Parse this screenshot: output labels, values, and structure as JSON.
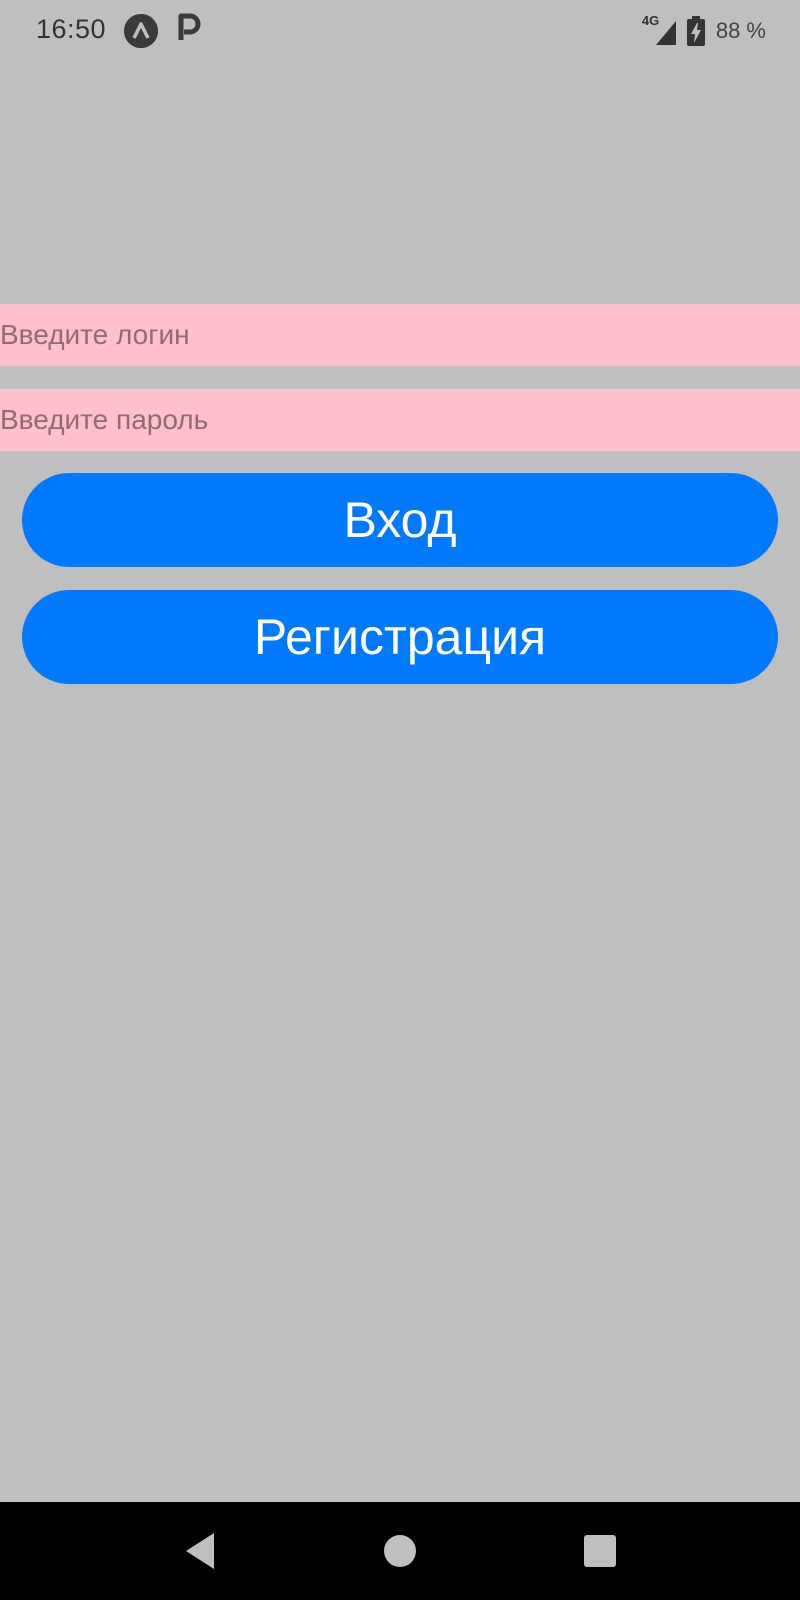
{
  "status_bar": {
    "time": "16:50",
    "notification_icons": [
      "arc-a-icon",
      "p-icon"
    ],
    "network_label": "4G",
    "battery_text": "88 %"
  },
  "login_form": {
    "login_placeholder": "Введите логин",
    "login_value": "",
    "password_placeholder": "Введите пароль",
    "password_value": "",
    "login_button_label": "Вход",
    "register_button_label": "Регистрация"
  },
  "nav_bar": {
    "icons": [
      "back-icon",
      "home-icon",
      "recents-icon"
    ]
  },
  "colors": {
    "background": "#bfbfbf",
    "field_background": "#ffc0cb",
    "button_background": "#0079fd",
    "button_text": "#ffffff",
    "nav_bar": "#000000"
  }
}
